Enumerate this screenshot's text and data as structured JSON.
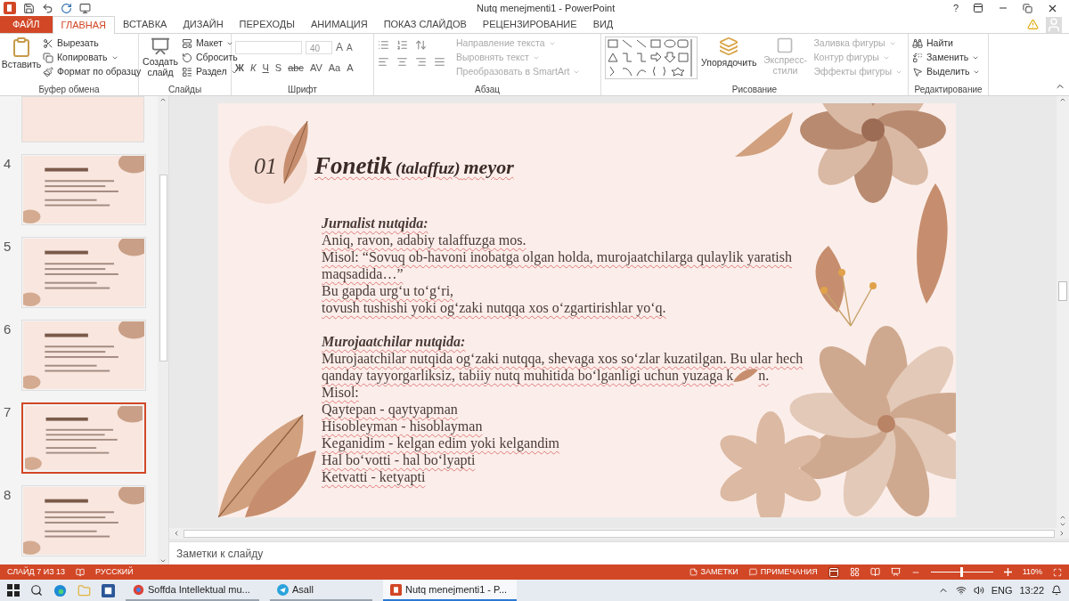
{
  "window": {
    "title": "Nutq menejmenti1 - PowerPoint",
    "help": "?"
  },
  "tabs": [
    {
      "label": "ФАЙЛ",
      "kind": "file",
      "selected": false
    },
    {
      "label": "ГЛАВНАЯ",
      "kind": "tab",
      "selected": true
    },
    {
      "label": "ВСТАВКА",
      "kind": "tab",
      "selected": false
    },
    {
      "label": "ДИЗАЙН",
      "kind": "tab",
      "selected": false
    },
    {
      "label": "ПЕРЕХОДЫ",
      "kind": "tab",
      "selected": false
    },
    {
      "label": "АНИМАЦИЯ",
      "kind": "tab",
      "selected": false
    },
    {
      "label": "ПОКАЗ СЛАЙДОВ",
      "kind": "tab",
      "selected": false
    },
    {
      "label": "РЕЦЕНЗИРОВАНИЕ",
      "kind": "tab",
      "selected": false
    },
    {
      "label": "ВИД",
      "kind": "tab",
      "selected": false
    }
  ],
  "ribbon": {
    "clipboard": {
      "title": "Буфер обмена",
      "paste": "Вставить",
      "items": [
        {
          "label": "Вырезать"
        },
        {
          "label": "Копировать"
        },
        {
          "label": "Формат по образцу"
        }
      ]
    },
    "slides": {
      "title": "Слайды",
      "new_slide": "Создать слайд",
      "items": [
        {
          "label": "Макет"
        },
        {
          "label": "Сбросить"
        },
        {
          "label": "Раздел"
        }
      ]
    },
    "font": {
      "title": "Шрифт",
      "size": "40",
      "grow": "A",
      "shrink": "A",
      "buttons": [
        "Ж",
        "К",
        "Ч",
        "S",
        "abc",
        "AV",
        "Aa",
        "A"
      ]
    },
    "paragraph": {
      "title": "Абзац",
      "items": [
        {
          "label": "Направление текста",
          "disabled": true
        },
        {
          "label": "Выровнять текст",
          "disabled": true
        },
        {
          "label": "Преобразовать в SmartArt",
          "disabled": true
        }
      ]
    },
    "drawing": {
      "title": "Рисование",
      "arrange": "Упорядочить",
      "styles": {
        "label": "Экспресс-стили",
        "disabled": true
      },
      "items": [
        {
          "label": "Заливка фигуры",
          "disabled": true
        },
        {
          "label": "Контур фигуры",
          "disabled": true
        },
        {
          "label": "Эффекты фигуры",
          "disabled": true
        }
      ]
    },
    "editing": {
      "title": "Редактирование",
      "items": [
        {
          "label": "Найти"
        },
        {
          "label": "Заменить"
        },
        {
          "label": "Выделить"
        }
      ]
    }
  },
  "thumbnails": [
    {
      "number": "4",
      "selected": false
    },
    {
      "number": "5",
      "selected": false
    },
    {
      "number": "6",
      "selected": false
    },
    {
      "number": "7",
      "selected": true
    },
    {
      "number": "8",
      "selected": false
    }
  ],
  "slide": {
    "number": "01",
    "title": {
      "main": "Fonetik",
      "paren": "(talaffuz)",
      "rest": "meyor"
    },
    "blocks": [
      {
        "kind": "heading",
        "text": "Jurnalist nutqida:"
      },
      {
        "kind": "text",
        "text": "Aniq, ravon, adabiy talaffuzga mos."
      },
      {
        "kind": "text",
        "text": "Misol: “Sovuq ob-havoni inobatga olgan holda, murojaatchilarga qulaylik yaratish maqsadida…”"
      },
      {
        "kind": "text",
        "text": "Bu gapda urg‘u to‘g‘ri,"
      },
      {
        "kind": "text",
        "text": "tovush tushishi yoki og‘zaki nutqqa xos o‘zgartirishlar yo‘q."
      },
      {
        "kind": "gap"
      },
      {
        "kind": "heading",
        "text": "Murojaatchilar nutqida:"
      },
      {
        "kind": "text",
        "text": "Murojaatchilar nutqida og‘zaki nutqqa, shevaga xos so‘zlar kuzatilgan. Bu ular hech"
      },
      {
        "kind": "covered",
        "text": "qanday tayyorgarliksiz, tabiiy nutq muhitida bo‘lganligi uchun yuzaga k",
        "tail": "n."
      },
      {
        "kind": "text",
        "text": "Misol:"
      },
      {
        "kind": "text",
        "text": "Qaytepan - qaytyapman"
      },
      {
        "kind": "text",
        "text": "Hisobleyman - hisoblayman"
      },
      {
        "kind": "text",
        "text": "Keganidim - kelgan edim yoki kelgandim"
      },
      {
        "kind": "text",
        "text": "Hal bo‘votti - hal bo‘lyapti"
      },
      {
        "kind": "text",
        "text": "Ketvatti - ketyapti"
      }
    ]
  },
  "notes": {
    "placeholder": "Заметки к слайду"
  },
  "status_bar": {
    "slide": "СЛАЙД 7 ИЗ 13",
    "language": "РУССКИЙ",
    "notes": "ЗАМЕТКИ",
    "comments": "ПРИМЕЧАНИЯ",
    "zoom": {
      "level": 0.47
    },
    "zoom_text": "110%"
  },
  "taskbar": {
    "apps": [
      {
        "kind": "browser",
        "label": "Soffda Intellektual mu...",
        "selected": false
      },
      {
        "kind": "telegram",
        "label": "Asall",
        "selected": false
      },
      {
        "kind": "powerpoint",
        "label": "Nutq menejmenti1 - P...",
        "selected": true
      }
    ],
    "language": "ENG",
    "time": "13:22"
  }
}
